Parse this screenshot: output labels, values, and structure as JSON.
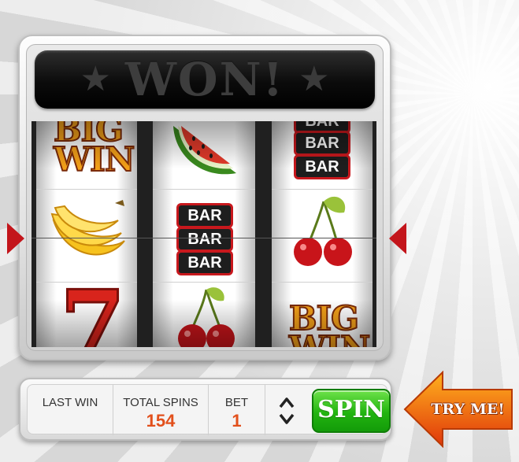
{
  "header": {
    "title": "WON!",
    "star_icon": "star-icon"
  },
  "reels": {
    "reel1": [
      "BIG WIN",
      "banana",
      "seven"
    ],
    "reel2": [
      "watermelon",
      "BAR BAR BAR",
      "cherry"
    ],
    "reel3": [
      "BAR BAR",
      "cherry",
      "BIG WIN"
    ]
  },
  "symbols": {
    "big_line1": "BIG",
    "big_line2": "WIN",
    "bar": "BAR",
    "seven": "7"
  },
  "panel": {
    "last_win_label": "LAST WIN",
    "last_win_value": "",
    "total_spins_label": "TOTAL SPINS",
    "total_spins_value": "154",
    "bet_label": "BET",
    "bet_value": "1",
    "spin_label": "SPIN",
    "stepper_icon": "up-down-chevron-icon"
  },
  "promo": {
    "try_me": "TRY ME!"
  },
  "colors": {
    "accent": "#e2501c",
    "spin": "#22b410",
    "arrow": "#c3151b",
    "try_me": "#f08a10"
  }
}
